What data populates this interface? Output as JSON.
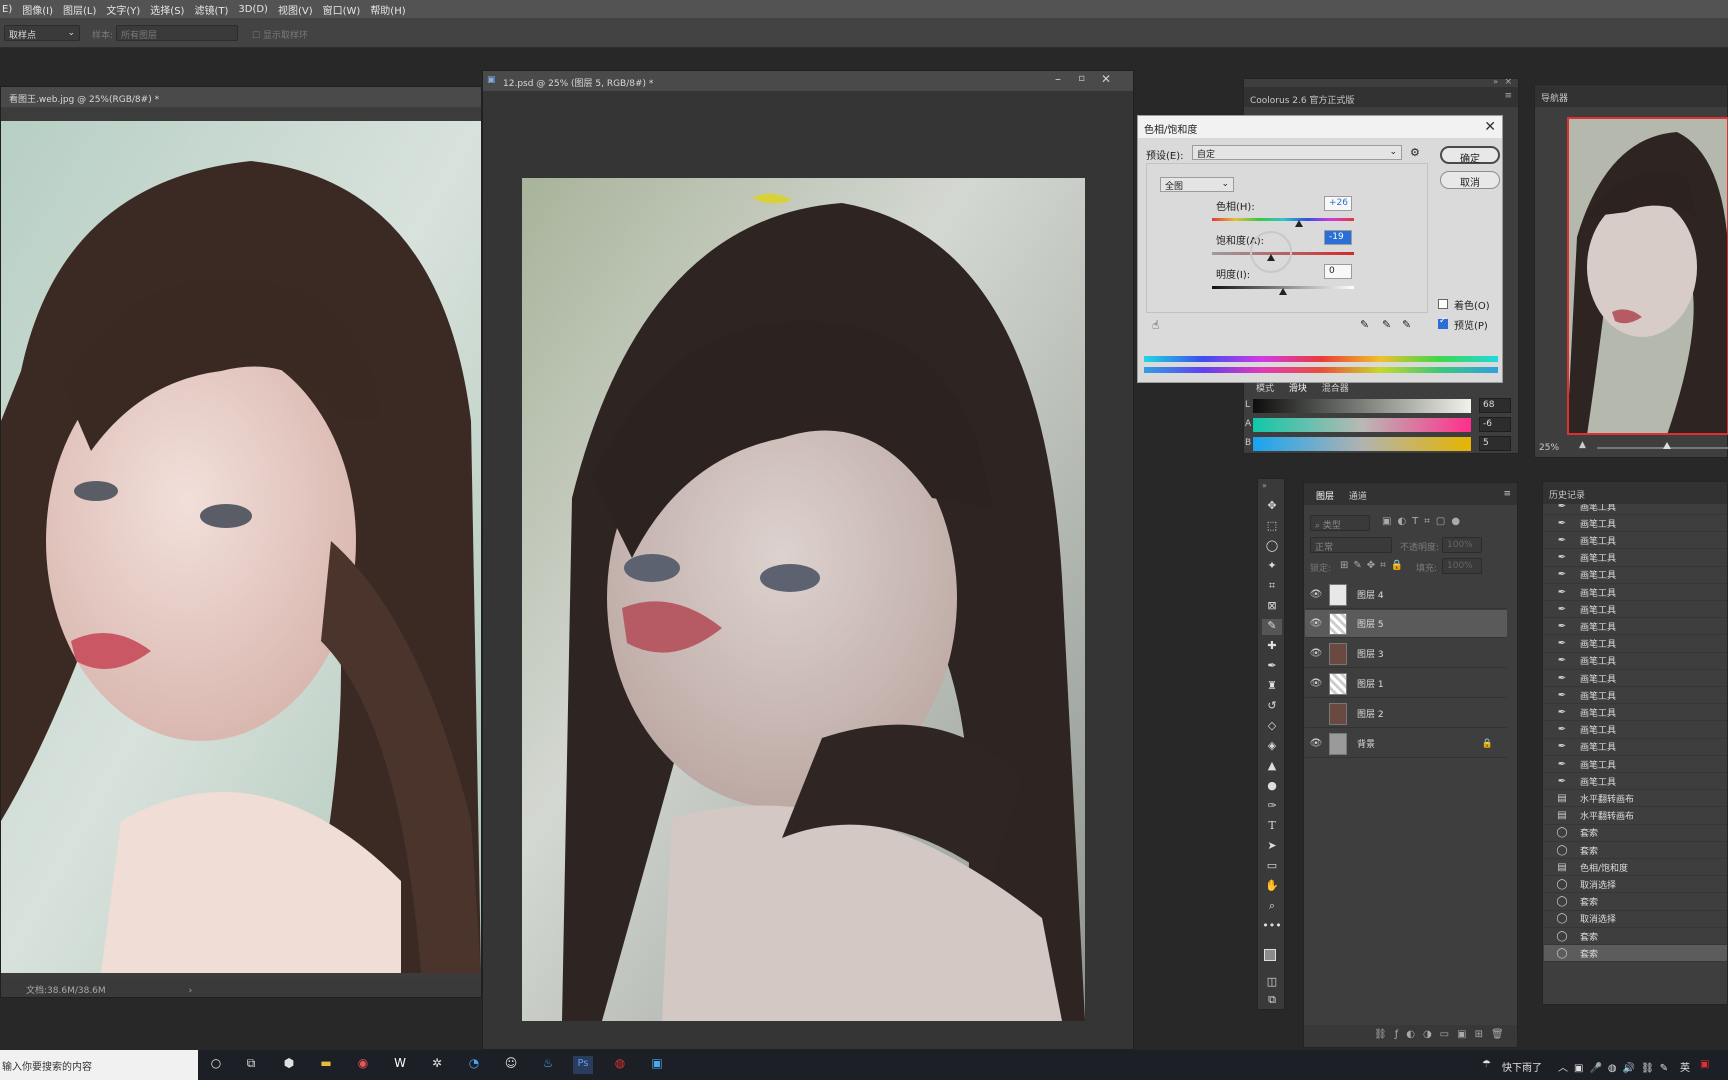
{
  "menu": [
    "E)",
    "图像(I)",
    "图层(L)",
    "文字(Y)",
    "选择(S)",
    "滤镜(T)",
    "3D(D)",
    "视图(V)",
    "窗口(W)",
    "帮助(H)"
  ],
  "options": {
    "sample_size": "取样点",
    "sample_label": "样本:",
    "sample_value": "所有图层",
    "show_ring": "显示取样环"
  },
  "doc_left": {
    "title": "看图王.web.jpg @ 25%(RGB/8#) *",
    "status": "文档:38.6M/38.6M"
  },
  "doc_main": {
    "title": "12.psd @ 25% (图层 5, RGB/8#) *"
  },
  "coolorus": {
    "title": "Coolorus 2.6 官方正式版",
    "tabs": [
      "模式",
      "滑块",
      "混合器"
    ],
    "lab": [
      {
        "label": "L",
        "value": "68"
      },
      {
        "label": "A",
        "value": "-6"
      },
      {
        "label": "B",
        "value": "5"
      }
    ]
  },
  "dialog": {
    "title": "色相/饱和度",
    "preset_label": "预设(E):",
    "preset_value": "自定",
    "ok": "确定",
    "cancel": "取消",
    "channel": "全图",
    "hue_label": "色相(H):",
    "hue_value": "+26",
    "sat_label": "饱和度(A):",
    "sat_value": "-19",
    "light_label": "明度(I):",
    "light_value": "0",
    "colorize": "着色(O)",
    "preview": "预览(P)"
  },
  "navigator": {
    "title": "导航器",
    "zoom": "25%"
  },
  "layers": {
    "tabs": [
      "图层",
      "通道"
    ],
    "filter": "类型",
    "blend": "正常",
    "opacity_label": "不透明度:",
    "opacity_value": "100%",
    "lock_label": "锁定:",
    "fill_label": "填充:",
    "fill_value": "100%",
    "items": [
      {
        "name": "图层 4",
        "visible": true
      },
      {
        "name": "图层 5",
        "visible": true
      },
      {
        "name": "图层 3",
        "visible": true
      },
      {
        "name": "图层 1",
        "visible": true
      },
      {
        "name": "图层 2",
        "visible": false
      },
      {
        "name": "背景",
        "visible": true
      }
    ]
  },
  "history": {
    "title": "历史记录",
    "items": [
      "画笔工具",
      "画笔工具",
      "画笔工具",
      "画笔工具",
      "画笔工具",
      "画笔工具",
      "画笔工具",
      "画笔工具",
      "画笔工具",
      "画笔工具",
      "画笔工具",
      "画笔工具",
      "画笔工具",
      "画笔工具",
      "画笔工具",
      "画笔工具",
      "画笔工具",
      "水平翻转画布",
      "水平翻转画布",
      "套索",
      "套索",
      "色相/饱和度",
      "取消选择",
      "套索",
      "取消选择",
      "套索",
      "套索"
    ]
  },
  "taskbar": {
    "search": "输入你要搜索的内容",
    "weather": "快下雨了",
    "lang": "英"
  }
}
